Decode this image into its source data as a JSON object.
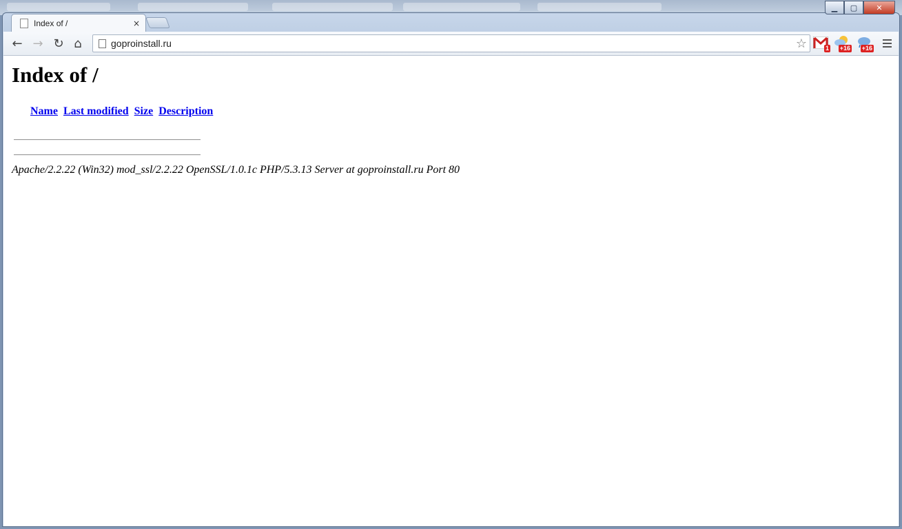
{
  "browser": {
    "tab": {
      "title": "Index of /",
      "close_glyph": "×"
    },
    "address": {
      "url": "goproinstall.ru"
    },
    "caption": {
      "minimize": "▁",
      "maximize": "▢",
      "close": "✕"
    },
    "nav": {
      "back": "←",
      "forward": "→",
      "reload": "↻",
      "home": "⌂",
      "star": "☆"
    },
    "extensions": [
      {
        "name": "gmail-icon",
        "badge": "1",
        "color": "#cc2222"
      },
      {
        "name": "weather-icon",
        "badge": "+16",
        "color": "#2f74c8"
      },
      {
        "name": "cloud-weather-icon",
        "badge": "+16",
        "color": "#2f74c8"
      }
    ]
  },
  "page": {
    "heading": "Index of /",
    "columns": {
      "name": "Name",
      "last_modified": "Last modified",
      "size": "Size",
      "description": "Description"
    },
    "footer": "Apache/2.2.22 (Win32) mod_ssl/2.2.22 OpenSSL/1.0.1c PHP/5.3.13 Server at goproinstall.ru Port 80"
  }
}
